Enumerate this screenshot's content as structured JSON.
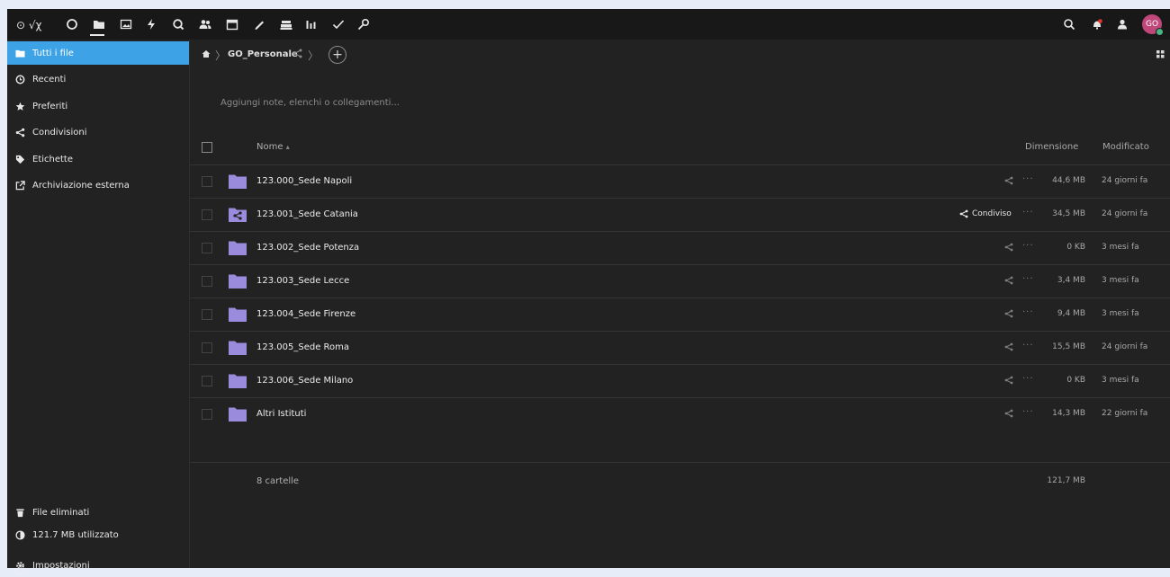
{
  "topbar": {
    "logo": "⊙ √χ",
    "avatar": "GO",
    "apps": [
      "dashboard-icon",
      "files-icon",
      "photos-icon",
      "activity-icon",
      "search-icon",
      "contacts-icon",
      "calendar-icon",
      "notes-icon",
      "deck-icon",
      "analytics-icon",
      "tasks-icon",
      "keys-icon"
    ]
  },
  "sidebar": {
    "items": [
      {
        "label": "Tutti i file",
        "icon": "folder-icon"
      },
      {
        "label": "Recenti",
        "icon": "clock-icon"
      },
      {
        "label": "Preferiti",
        "icon": "star-icon"
      },
      {
        "label": "Condivisioni",
        "icon": "share-icon"
      },
      {
        "label": "Etichette",
        "icon": "tag-icon"
      },
      {
        "label": "Archiviazione esterna",
        "icon": "external-storage-icon"
      }
    ],
    "bottom": [
      {
        "label": "File eliminati",
        "icon": "trash-icon"
      },
      {
        "label": "121.7 MB utilizzato",
        "icon": "quota-icon"
      },
      {
        "label": "Impostazioni",
        "icon": "gear-icon"
      }
    ]
  },
  "breadcrumb": {
    "current": "GO_Personale"
  },
  "notes_placeholder": "Aggiungi note, elenchi o collegamenti...",
  "table": {
    "col_name": "Nome",
    "sort_indicator": "▴",
    "col_size": "Dimensione",
    "col_modified": "Modificato",
    "rows": [
      {
        "name": "123.000_Sede Napoli",
        "size": "44,6 MB",
        "modified": "24 giorni fa",
        "shared": false,
        "share_label": ""
      },
      {
        "name": "123.001_Sede Catania",
        "size": "34,5 MB",
        "modified": "24 giorni fa",
        "shared": true,
        "share_label": "Condiviso"
      },
      {
        "name": "123.002_Sede Potenza",
        "size": "0 KB",
        "modified": "3 mesi fa",
        "shared": false,
        "share_label": ""
      },
      {
        "name": "123.003_Sede Lecce",
        "size": "3,4 MB",
        "modified": "3 mesi fa",
        "shared": false,
        "share_label": ""
      },
      {
        "name": "123.004_Sede Firenze",
        "size": "9,4 MB",
        "modified": "3 mesi fa",
        "shared": false,
        "share_label": ""
      },
      {
        "name": "123.005_Sede Roma",
        "size": "15,5 MB",
        "modified": "24 giorni fa",
        "shared": false,
        "share_label": ""
      },
      {
        "name": "123.006_Sede Milano",
        "size": "0 KB",
        "modified": "3 mesi fa",
        "shared": false,
        "share_label": ""
      },
      {
        "name": "Altri Istituti",
        "size": "14,3 MB",
        "modified": "22 giorni fa",
        "shared": false,
        "share_label": ""
      }
    ],
    "summary_count": "8 cartelle",
    "summary_size": "121,7 MB"
  },
  "colors": {
    "accent": "#3ea3e6",
    "folder": "#9b8bdd",
    "background": "#222222",
    "topbar": "#181818"
  }
}
